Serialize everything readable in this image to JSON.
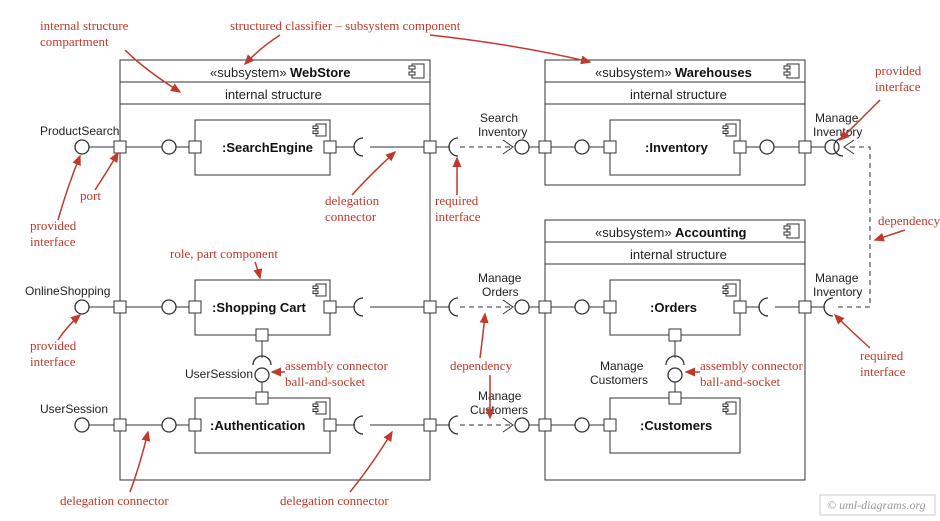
{
  "subsystems": {
    "webstore": {
      "stereotype": "«subsystem»",
      "name": "WebStore",
      "section": "internal structure",
      "parts": {
        "searchengine": ":SearchEngine",
        "shoppingcart": ":Shopping Cart",
        "authentication": ":Authentication"
      }
    },
    "warehouses": {
      "stereotype": "«subsystem»",
      "name": "Warehouses",
      "section": "internal structure",
      "parts": {
        "inventory": ":Inventory"
      }
    },
    "accounting": {
      "stereotype": "«subsystem»",
      "name": "Accounting",
      "section": "internal structure",
      "parts": {
        "orders": ":Orders",
        "customers": ":Customers"
      }
    }
  },
  "interfaces": {
    "productsearch": "ProductSearch",
    "onlineshopping": "OnlineShopping",
    "usersession": "UserSession",
    "usersession_inner": "UserSession",
    "searchinventory": "Search\nInventory",
    "manageorders": "Manage\nOrders",
    "managecustomers": "Manage\nCustomers",
    "managecustomers2": "Manage\nCustomers",
    "manageinventory": "Manage\nInventory",
    "manageinventory2": "Manage\nInventory"
  },
  "annotations": {
    "internal_structure": "internal structure\ncompartment",
    "structured_classifier": "structured classifier – subsystem component",
    "provided_interface_tr": "provided\ninterface",
    "port": "port",
    "provided_interface_bl": "provided\ninterface",
    "delegation_connector1": "delegation\nconnector",
    "required_interface1": "required\ninterface",
    "role_part": "role, part component",
    "assembly_connector1": "assembly connector\nball-and-socket",
    "dependency1": "dependency",
    "delegation_connector2": "delegation connector",
    "delegation_connector3": "delegation connector",
    "dependency2": "dependency",
    "required_interface2": "required\ninterface",
    "assembly_connector2": "assembly connector\nball-and-socket",
    "provided_interface_ml": "provided\ninterface"
  },
  "copyright": "© uml-diagrams.org"
}
